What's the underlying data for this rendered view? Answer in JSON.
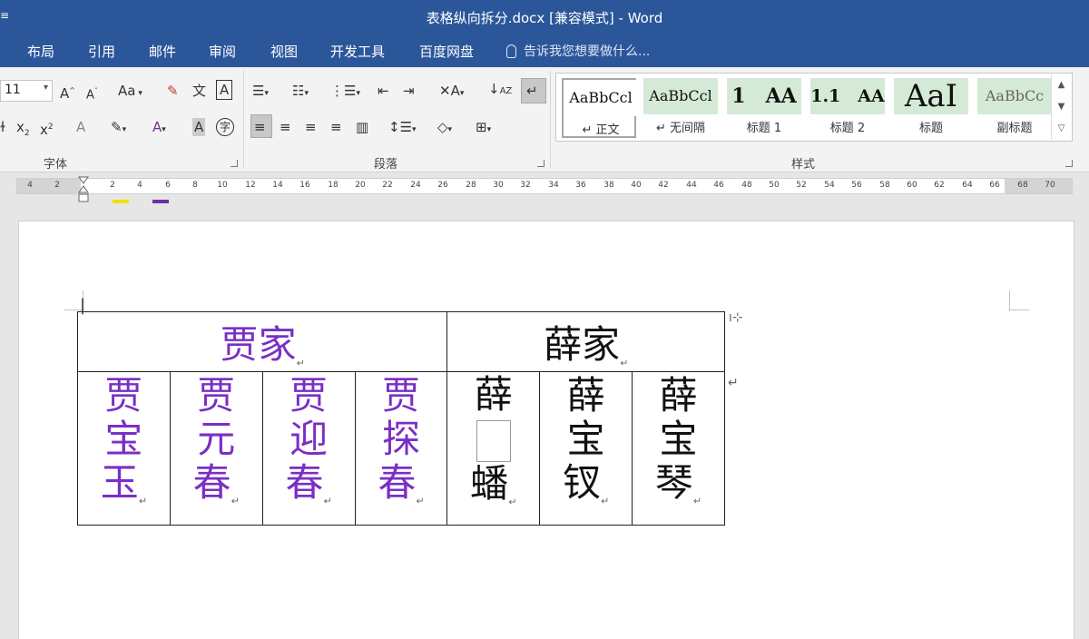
{
  "window": {
    "title": "表格纵向拆分.docx [兼容模式] - Word",
    "sys_icon": "≡"
  },
  "tabs": [
    "布局",
    "引用",
    "邮件",
    "审阅",
    "视图",
    "开发工具",
    "百度网盘"
  ],
  "tell_me": "告诉我您想要做什么...",
  "font_group": {
    "size": "11",
    "case_label": "Aa",
    "label": "字体"
  },
  "paragraph_group": {
    "label": "段落"
  },
  "styles_group": {
    "label": "样式",
    "items": [
      {
        "preview": "AaBbCcl",
        "name": "正文"
      },
      {
        "preview": "AaBbCcl",
        "name": "无间隔"
      },
      {
        "preview": "1　AA",
        "name": "标题 1"
      },
      {
        "preview": "1.1　AA",
        "name": "标题 2"
      },
      {
        "preview": "AaI",
        "name": "标题"
      },
      {
        "preview": "AaBbCc",
        "name": "副标题"
      }
    ]
  },
  "ruler_ticks": [
    "4",
    "2",
    "2",
    "4",
    "6",
    "8",
    "10",
    "12",
    "14",
    "16",
    "18",
    "20",
    "22",
    "24",
    "26",
    "28",
    "30",
    "32",
    "34",
    "36",
    "38",
    "40",
    "42",
    "44",
    "46",
    "48",
    "50",
    "52",
    "54",
    "56",
    "58",
    "60",
    "62",
    "64",
    "66",
    "68",
    "70"
  ],
  "document": {
    "table": {
      "headers": [
        {
          "text": "贾家",
          "color": "#7a2fc4"
        },
        {
          "text": "薛家",
          "color": "#111111"
        }
      ],
      "cells": [
        {
          "lines": [
            "贾",
            "宝",
            "玉"
          ],
          "color": "#7a2fc4"
        },
        {
          "lines": [
            "贾",
            "元",
            "春"
          ],
          "color": "#7a2fc4"
        },
        {
          "lines": [
            "贾",
            "迎",
            "春"
          ],
          "color": "#7a2fc4"
        },
        {
          "lines": [
            "贾",
            "探",
            "春"
          ],
          "color": "#7a2fc4"
        },
        {
          "lines": [
            "薛",
            "",
            "蟠"
          ],
          "color": "#111111"
        },
        {
          "lines": [
            "薛",
            "宝",
            "钗"
          ],
          "color": "#111111"
        },
        {
          "lines": [
            "薛",
            "宝",
            "琴"
          ],
          "color": "#111111"
        }
      ]
    },
    "para_mark": "↵"
  }
}
